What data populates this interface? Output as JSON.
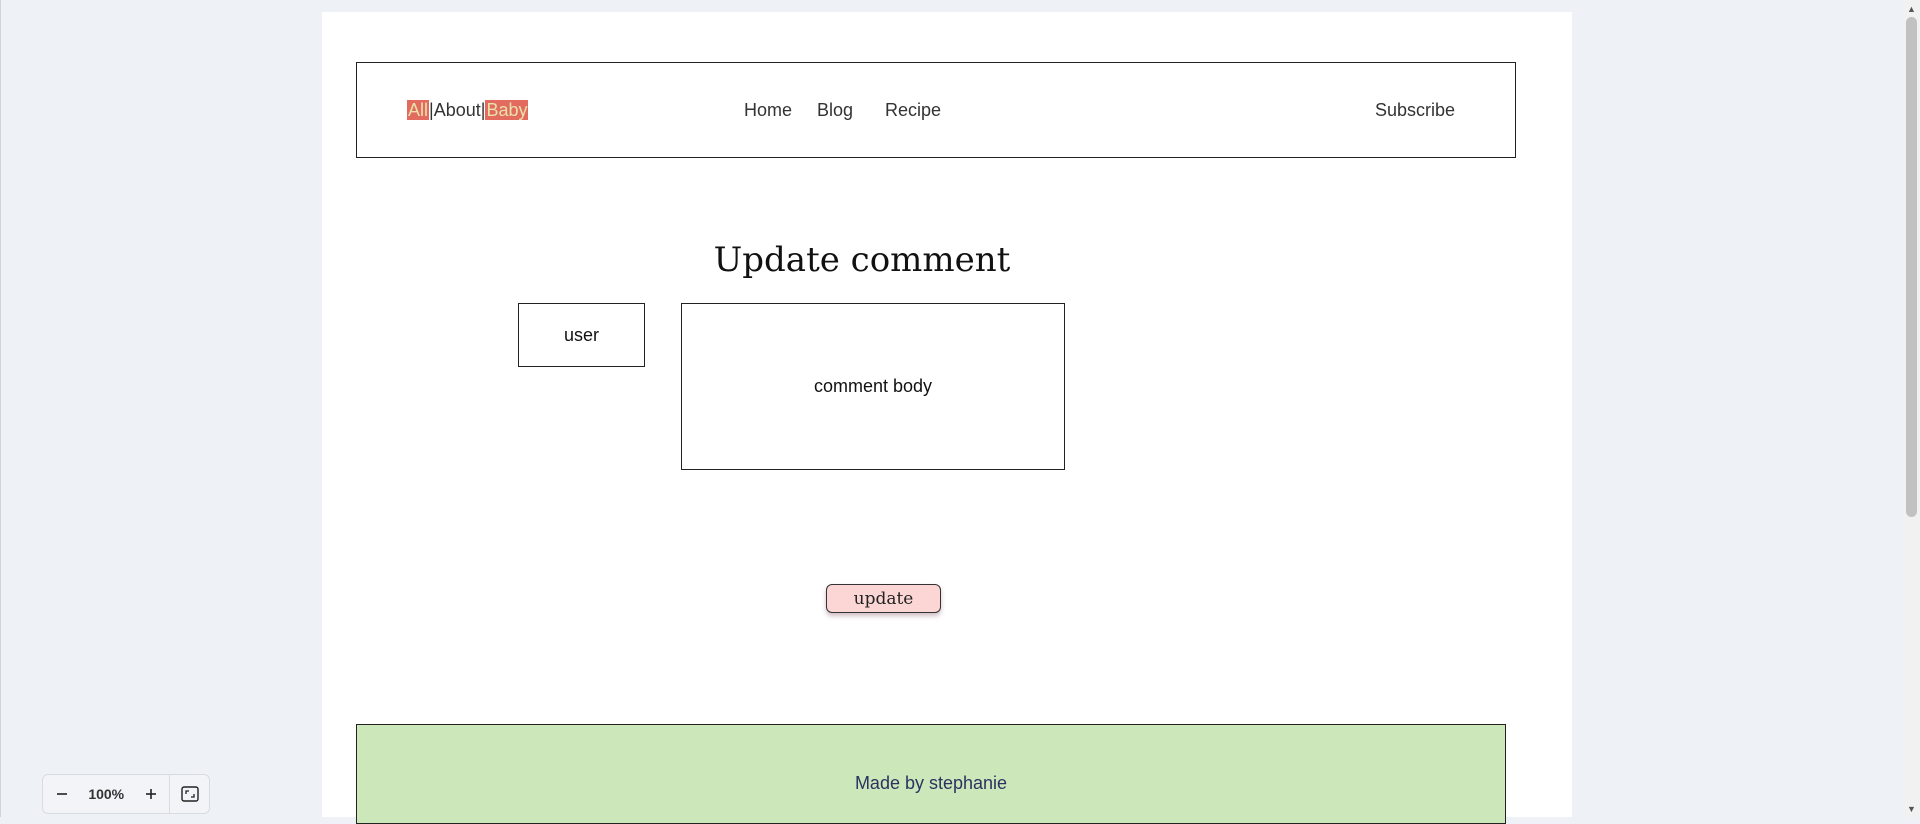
{
  "header": {
    "logo": {
      "part1": "All",
      "sep1": "|",
      "part2": "About",
      "sep2": "|",
      "part3": "Baby"
    },
    "nav": [
      {
        "label": "Home"
      },
      {
        "label": "Blog"
      },
      {
        "label": "Recipe"
      }
    ],
    "subscribe_label": "Subscribe"
  },
  "main": {
    "title": "Update comment",
    "user_field": "user",
    "comment_field": "comment body",
    "update_button": "update"
  },
  "footer": {
    "text": "Made by stephanie"
  },
  "zoom": {
    "minus_icon": "minus-icon",
    "value": "100%",
    "plus_icon": "plus-icon",
    "fit_icon": "fit-screen-icon"
  },
  "colors": {
    "logo_highlight_bg": "#e26a5f",
    "logo_highlight_text": "#e9e2a8",
    "button_bg": "#fcd6d4",
    "footer_bg": "#cce8bb",
    "footer_text": "#2c3260"
  }
}
